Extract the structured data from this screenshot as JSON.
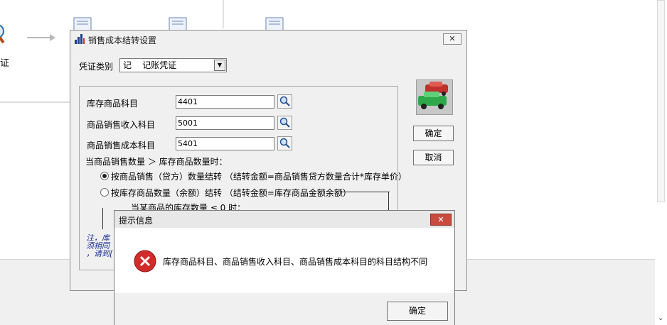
{
  "background": {
    "partial_label": "证"
  },
  "dialog": {
    "title": "销售成本结转设置",
    "close_label": "✕",
    "voucher_type": {
      "label": "凭证类别",
      "value": "记    记账凭证"
    },
    "fields": [
      {
        "label": "库存商品科目",
        "value": "4401"
      },
      {
        "label": "商品销售收入科目",
        "value": "5001"
      },
      {
        "label": "商品销售成本科目",
        "value": "5401"
      }
    ],
    "condition_text": "当商品销售数量 ＞ 库存商品数量时：",
    "options": [
      {
        "label": "按商品销售（贷方）数量结转 （结转金额=商品销售贷方数量合计*库存单价）",
        "selected": true
      },
      {
        "label": "按库存商品数量（余额）结转 （结转金额=库存商品金额余额）",
        "selected": false
      }
    ],
    "sub_condition": "当某商品的库存数量 ≤ 0 时：",
    "note": "注，库 须相同 ，请到[",
    "confirm_label": "确定",
    "cancel_label": "取消"
  },
  "message_box": {
    "title": "提示信息",
    "close_label": "✕",
    "message": "库存商品科目、商品销售收入科目、商品销售成本科目的科目结构不同",
    "ok_label": "确定"
  },
  "colors": {
    "dialog_bg": "#f0f0f0",
    "close_red": "#c84b3d",
    "note_blue": "#1b2f8f",
    "error_red": "#d22b2b"
  }
}
